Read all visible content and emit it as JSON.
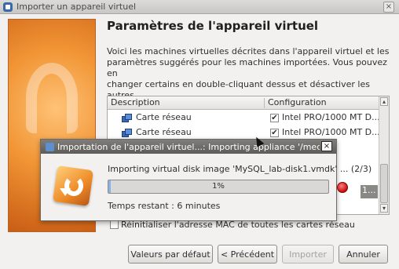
{
  "window": {
    "title": "Importer un appareil virtuel",
    "close_glyph": "×"
  },
  "page": {
    "title": "Paramètres de l'appareil virtuel",
    "intro": "Voici les machines virtuelles décrites dans l'appareil virtuel et les\nparamètres suggérés pour les machines importées. Vous pouvez en\nchanger certains en double-cliquant dessus et désactiver les autres\navec les cases à cocher."
  },
  "table": {
    "columns": [
      "Description",
      "Configuration"
    ],
    "rows": [
      {
        "description": "Carte réseau",
        "checked": true,
        "configuration": "Intel PRO/1000 MT D..."
      },
      {
        "description": "Carte réseau",
        "checked": true,
        "configuration": "Intel PRO/1000 MT D..."
      }
    ],
    "fragment_text": "1...",
    "scroll_up": "▴",
    "scroll_down": "▾"
  },
  "reset_mac_label": "Réinitialiser l'adresse MAC de toutes les cartes réseau",
  "buttons": {
    "defaults": "Valeurs par défaut",
    "back": "< Précédent",
    "import": "Importer",
    "cancel": "Annuler"
  },
  "dialog": {
    "title": "Importation de l'appareil virtuel...: Importing appliance '/media/pio/...",
    "close_glyph": "×",
    "status": "Importing virtual disk image 'MySQL_lab-disk1.vmdk' ... (2/3)",
    "progress_value": 0.01,
    "progress_text": "1%",
    "remaining": "Temps restant : 6 minutes"
  },
  "colors": {
    "accent": "#8fb1df",
    "stop": "#c80c0c",
    "brand_orange": "#f19535"
  }
}
